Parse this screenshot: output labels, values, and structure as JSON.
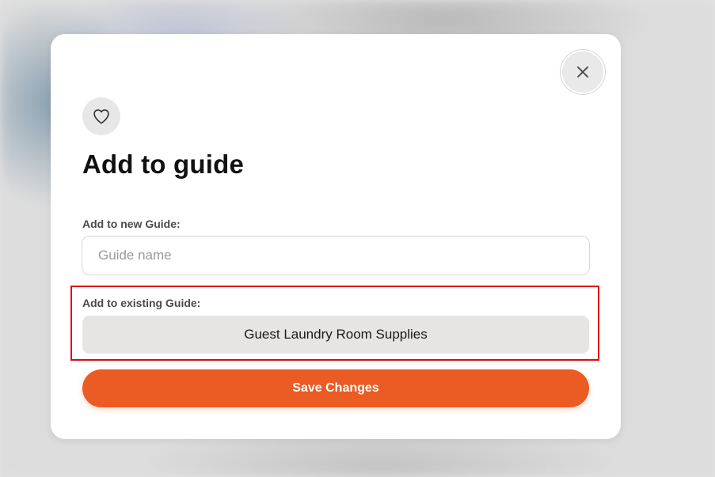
{
  "dialog": {
    "title": "Add to guide",
    "close_icon": "close-icon",
    "heart_icon": "heart-icon"
  },
  "new_guide": {
    "label": "Add to new Guide:",
    "value": "",
    "placeholder": "Guide name"
  },
  "existing_guide": {
    "label": "Add to existing Guide:",
    "option": "Guest Laundry Room Supplies"
  },
  "save_button": {
    "label": "Save Changes"
  },
  "colors": {
    "accent": "#eb5b24",
    "highlight": "#e30613",
    "option_bg": "#e6e5e4"
  }
}
